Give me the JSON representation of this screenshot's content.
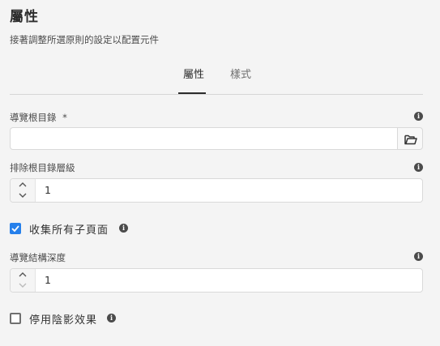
{
  "dialog": {
    "title": "屬性",
    "description": "接著調整所選原則的設定以配置元件"
  },
  "tabs": [
    {
      "label": "屬性",
      "active": true
    },
    {
      "label": "樣式",
      "active": false
    }
  ],
  "fields": {
    "nav_root": {
      "label": "導覽根目錄",
      "required_marker": "*",
      "value": "",
      "placeholder": ""
    },
    "exclude_root_levels": {
      "label": "排除根目錄層級",
      "value": "1"
    },
    "collect_all_child_pages": {
      "label": "收集所有子頁面",
      "checked": true
    },
    "structure_depth": {
      "label": "導覽結構深度",
      "value": "1"
    },
    "disable_shadowing": {
      "label": "停用陰影效果",
      "checked": false
    }
  },
  "icons": {
    "info": "info-icon",
    "browse": "folder-open-icon",
    "step_up": "chevron-up-icon",
    "step_down": "chevron-down-icon"
  },
  "colors": {
    "accent": "#2680eb",
    "text": "#323232",
    "background": "#f4f4f4"
  }
}
